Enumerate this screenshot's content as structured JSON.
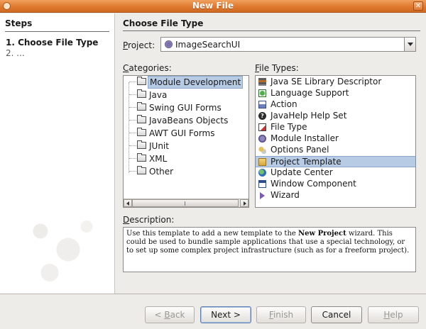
{
  "window": {
    "title": "New File",
    "close_glyph": "✕"
  },
  "steps": {
    "heading": "Steps",
    "items": [
      {
        "label": "1.  Choose File Type",
        "state": "current"
      },
      {
        "label": "2.  ...",
        "state": "pending"
      }
    ]
  },
  "main": {
    "title": "Choose File Type",
    "project": {
      "label_access": "P",
      "label_rest": "roject:",
      "value": "ImageSearchUI",
      "icon": "module-project-icon"
    },
    "categories": {
      "label_access": "C",
      "label_rest": "ategories:",
      "items": [
        {
          "label": "Module Development",
          "selected": true
        },
        {
          "label": "Java",
          "selected": false
        },
        {
          "label": "Swing GUI Forms",
          "selected": false
        },
        {
          "label": "JavaBeans Objects",
          "selected": false
        },
        {
          "label": "AWT GUI Forms",
          "selected": false
        },
        {
          "label": "JUnit",
          "selected": false
        },
        {
          "label": "XML",
          "selected": false
        },
        {
          "label": "Other",
          "selected": false
        }
      ]
    },
    "file_types": {
      "label_access": "F",
      "label_rest": "ile Types:",
      "items": [
        {
          "label": "Java SE Library Descriptor",
          "icon": "library-icon"
        },
        {
          "label": "Language Support",
          "icon": "language-support-icon"
        },
        {
          "label": "Action",
          "icon": "action-icon"
        },
        {
          "label": "JavaHelp Help Set",
          "icon": "help-icon"
        },
        {
          "label": "File Type",
          "icon": "file-type-icon"
        },
        {
          "label": "Module Installer",
          "icon": "module-installer-icon"
        },
        {
          "label": "Options Panel",
          "icon": "options-panel-icon"
        },
        {
          "label": "Project Template",
          "icon": "project-template-icon",
          "selected": true
        },
        {
          "label": "Update Center",
          "icon": "update-center-icon"
        },
        {
          "label": "Window Component",
          "icon": "window-component-icon"
        },
        {
          "label": "Wizard",
          "icon": "wizard-icon"
        }
      ]
    },
    "description": {
      "label_access": "D",
      "label_rest": "escription:",
      "text_before": "Use this template to add a new template to the ",
      "text_bold": "New Project",
      "text_after": " wizard. This could be used to bundle sample applications that use a special technology, or to set up some complex project infrastructure (such as for a freeform project)."
    }
  },
  "buttons": {
    "back": {
      "pre": "< ",
      "access": "B",
      "rest": "ack"
    },
    "next": "Next >",
    "finish": {
      "access": "F",
      "rest": "inish"
    },
    "cancel": "Cancel",
    "help": {
      "access": "H",
      "rest": "elp"
    }
  }
}
